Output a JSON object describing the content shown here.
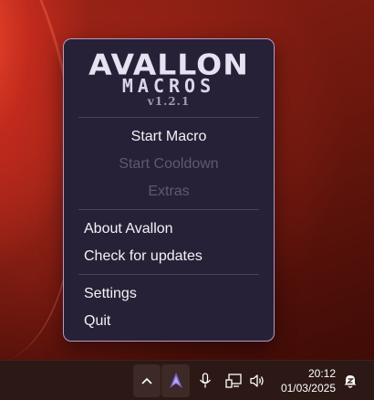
{
  "menu": {
    "logo_title": "AVALLON",
    "logo_subtitle": "MACROS",
    "logo_version": "v1.2.1",
    "items": [
      {
        "label": "Start Macro",
        "enabled": true
      },
      {
        "label": "Start Cooldown",
        "enabled": false
      },
      {
        "label": "Extras",
        "enabled": false
      },
      {
        "label": "About Avallon",
        "enabled": true
      },
      {
        "label": "Check for updates",
        "enabled": true
      },
      {
        "label": "Settings",
        "enabled": true
      },
      {
        "label": "Quit",
        "enabled": true
      }
    ]
  },
  "taskbar": {
    "time": "20:12",
    "date": "01/03/2025",
    "tray_icons": [
      "chevron-up-icon",
      "avallon-tray-icon",
      "microphone-icon",
      "network-icon",
      "volume-icon",
      "notification-bell-icon"
    ]
  },
  "colors": {
    "menu_bg": "#262136",
    "menu_border": "#b59ac9",
    "disabled_text": "#5e5970",
    "accent_purple": "#8b6fd6"
  }
}
